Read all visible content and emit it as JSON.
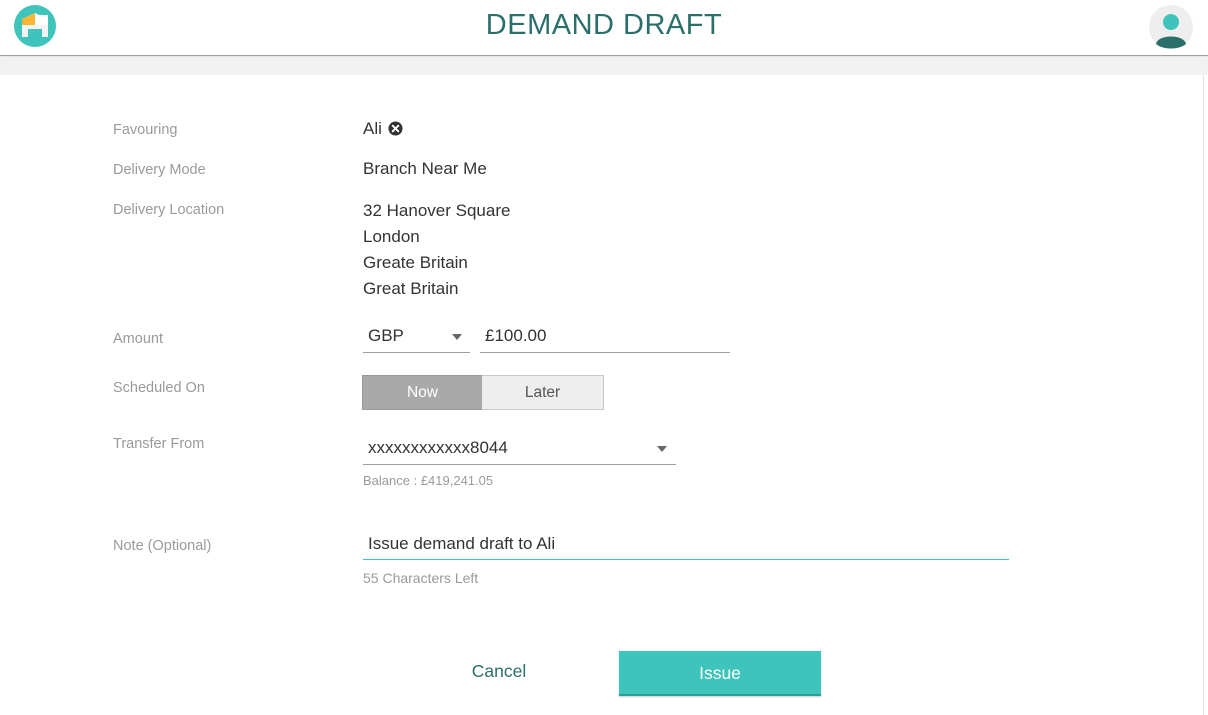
{
  "header": {
    "title": "DEMAND DRAFT",
    "logo_icon": "house-logo-icon",
    "avatar_icon": "user-avatar-icon"
  },
  "form": {
    "favouring": {
      "label": "Favouring",
      "value": "Ali",
      "remove_icon": "close-circle-icon"
    },
    "delivery_mode": {
      "label": "Delivery Mode",
      "value": "Branch Near Me"
    },
    "delivery_location": {
      "label": "Delivery Location",
      "lines": [
        "32 Hanover Square",
        "London",
        "Greate Britain",
        "Great Britain"
      ]
    },
    "amount": {
      "label": "Amount",
      "currency": "GBP",
      "value": "£100.00"
    },
    "scheduled_on": {
      "label": "Scheduled On",
      "options": [
        "Now",
        "Later"
      ],
      "selected": "Now"
    },
    "transfer_from": {
      "label": "Transfer From",
      "account": "xxxxxxxxxxxx8044",
      "balance": "Balance : £419,241.05"
    },
    "note": {
      "label": "Note (Optional)",
      "value": "Issue demand draft to Ali",
      "chars_left": "55 Characters Left"
    }
  },
  "actions": {
    "cancel": "Cancel",
    "issue": "Issue"
  },
  "colors": {
    "title": "#2b6f6b",
    "accent": "#3fc4bb",
    "segment_selected": "#a9a9a9",
    "label": "#9a9a9a"
  }
}
